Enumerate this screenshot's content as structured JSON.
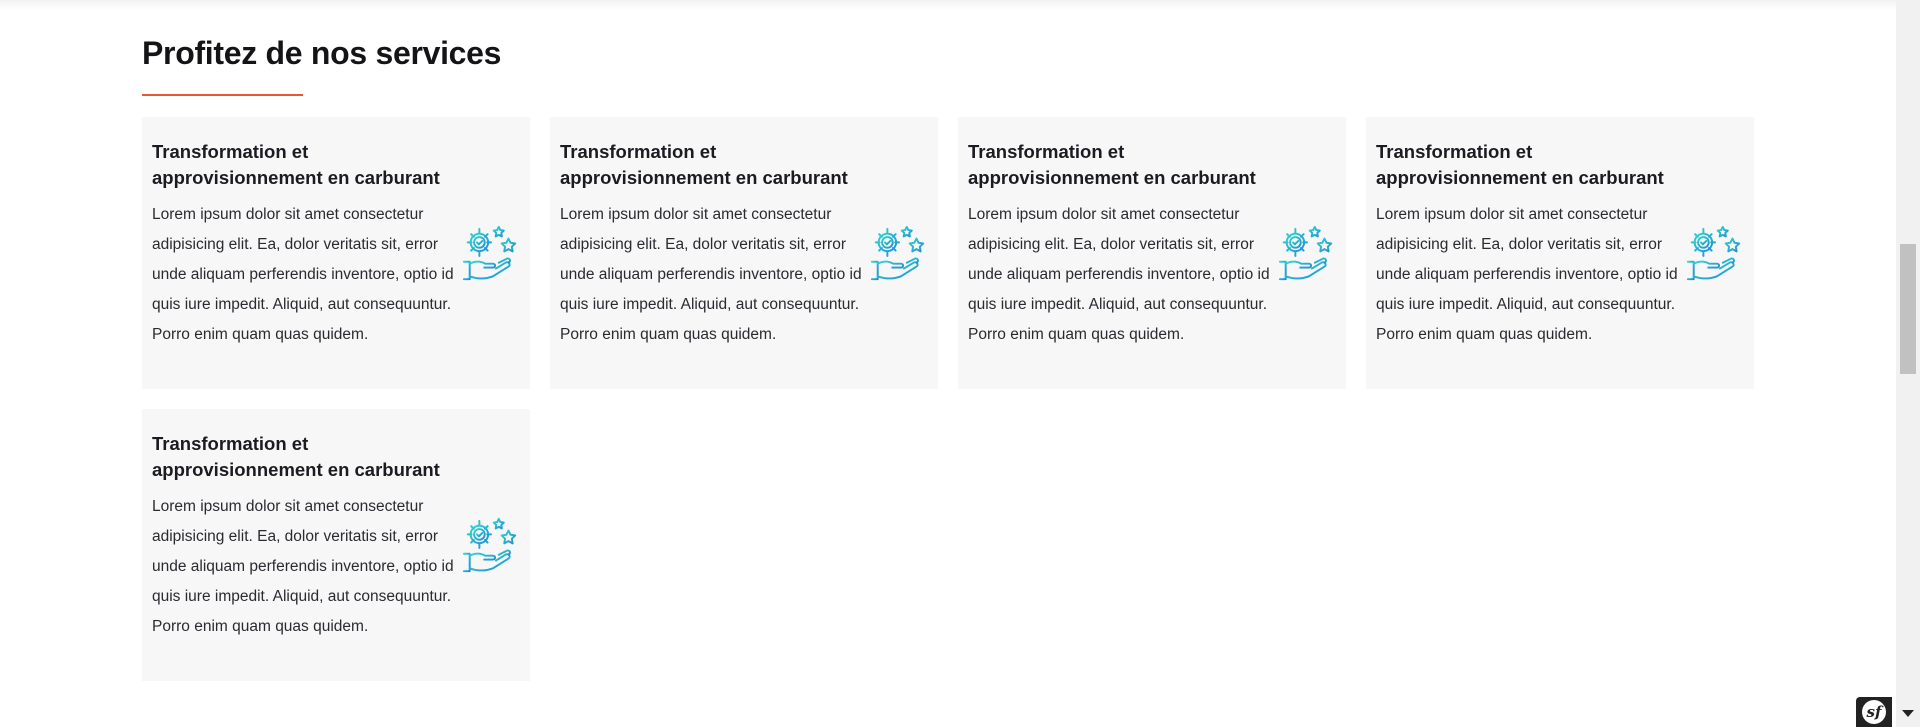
{
  "section": {
    "title": "Profitez de nos services",
    "accent_color": "#e8572f"
  },
  "cards": [
    {
      "title": "Transformation et approvisionnement en carburant",
      "text": "Lorem ipsum dolor sit amet consectetur adipisicing elit. Ea, dolor veritatis sit, error unde aliquam perferendis inventore, optio id quis iure impedit. Aliquid, aut consequuntur. Porro enim quam quas quidem.",
      "icon": "hand-gear-stars-icon"
    },
    {
      "title": "Transformation et approvisionnement en carburant",
      "text": "Lorem ipsum dolor sit amet consectetur adipisicing elit. Ea, dolor veritatis sit, error unde aliquam perferendis inventore, optio id quis iure impedit. Aliquid, aut consequuntur. Porro enim quam quas quidem.",
      "icon": "hand-gear-stars-icon"
    },
    {
      "title": "Transformation et approvisionnement en carburant",
      "text": "Lorem ipsum dolor sit amet consectetur adipisicing elit. Ea, dolor veritatis sit, error unde aliquam perferendis inventore, optio id quis iure impedit. Aliquid, aut consequuntur. Porro enim quam quas quidem.",
      "icon": "hand-gear-stars-icon"
    },
    {
      "title": "Transformation et approvisionnement en carburant",
      "text": "Lorem ipsum dolor sit amet consectetur adipisicing elit. Ea, dolor veritatis sit, error unde aliquam perferendis inventore, optio id quis iure impedit. Aliquid, aut consequuntur. Porro enim quam quas quidem.",
      "icon": "hand-gear-stars-icon"
    },
    {
      "title": "Transformation et approvisionnement en carburant",
      "text": "Lorem ipsum dolor sit amet consectetur adipisicing elit. Ea, dolor veritatis sit, error unde aliquam perferendis inventore, optio id quis iure impedit. Aliquid, aut consequuntur. Porro enim quam quas quidem.",
      "icon": "hand-gear-stars-icon"
    }
  ],
  "icon_colors": {
    "start": "#2fd6cf",
    "end": "#1f8fd6"
  },
  "toolbar": {
    "badge_icon": "symfony-logo-icon"
  }
}
